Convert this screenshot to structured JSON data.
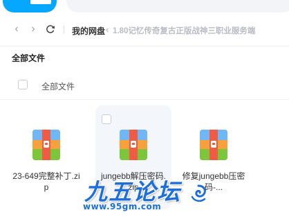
{
  "nav": {
    "back_icon": "chevron-left-icon",
    "forward_icon": "chevron-right-icon",
    "refresh_icon": "refresh-icon"
  },
  "breadcrumb": {
    "root": "我的网盘",
    "separator": "‹",
    "current": "1.80记忆传奇复古正版战神三职业服务端"
  },
  "section_title": "全部文件",
  "list_header_label": "全部文件",
  "files": [
    {
      "name": "23-649完整补丁.zip",
      "icon": "zip-archive-icon"
    },
    {
      "name": "jungebb解压密码.zip",
      "icon": "zip-archive-icon"
    },
    {
      "name": "修复jungebb压密码-...",
      "icon": "zip-archive-icon"
    }
  ],
  "watermark": {
    "title": "九五论坛",
    "url": "www.95gm.com"
  },
  "colors": {
    "accent": "#06a7ff",
    "watermark": "#1e6fd9"
  }
}
